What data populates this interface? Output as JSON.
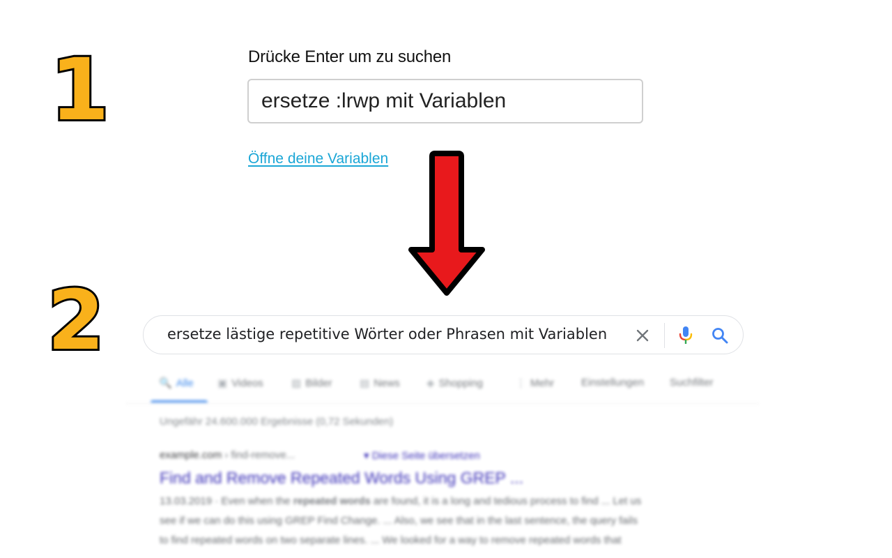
{
  "steps": {
    "first": "1",
    "second": "2"
  },
  "variable_search": {
    "label": "Drücke Enter um zu suchen",
    "value": "ersetze :lrwp mit Variablen",
    "open_variables_link": "Öffne deine Variablen"
  },
  "google_search": {
    "query": "ersetze lästige repetitive Wörter oder Phrasen mit Variablen"
  },
  "tabs": [
    {
      "label": "Alle",
      "glyph": "🔍"
    },
    {
      "label": "Videos",
      "glyph": "▣"
    },
    {
      "label": "Bilder",
      "glyph": "▨"
    },
    {
      "label": "News",
      "glyph": "▤"
    },
    {
      "label": "Shopping",
      "glyph": "◈"
    },
    {
      "label": "Mehr",
      "glyph": "⋮"
    },
    {
      "label": "Einstellungen",
      "glyph": ""
    },
    {
      "label": "Suchfilter",
      "glyph": ""
    }
  ],
  "results": {
    "stats": "Ungefähr 24.600.000 Ergebnisse (0,72 Sekunden)",
    "first": {
      "site": "example.com",
      "path": " › find-remove...",
      "translate": "▾ Diese Seite übersetzen",
      "title": "Find and Remove Repeated Words Using GREP ...",
      "snippet": [
        {
          "pre": "13.03.2019 · Even when the ",
          "strong": "repeated words",
          "post": " are found, it is a long and tedious process to find ... Let us"
        },
        {
          "pre": "see if we can do this using GREP Find Change. ... Also, we see that in the last sentence, the query fails",
          "strong": "",
          "post": ""
        },
        {
          "pre": "to find repeated words on two separate lines. ... We looked for a way to remove repeated words that",
          "strong": "",
          "post": ""
        }
      ]
    }
  },
  "colors": {
    "step_fill": "#f9b11b",
    "arrow_fill": "#e8191c",
    "link": "#1aa6d6",
    "google_blue": "#4285f4",
    "google_red": "#ea4335",
    "google_yellow": "#fbbc04",
    "google_green": "#34a853"
  }
}
